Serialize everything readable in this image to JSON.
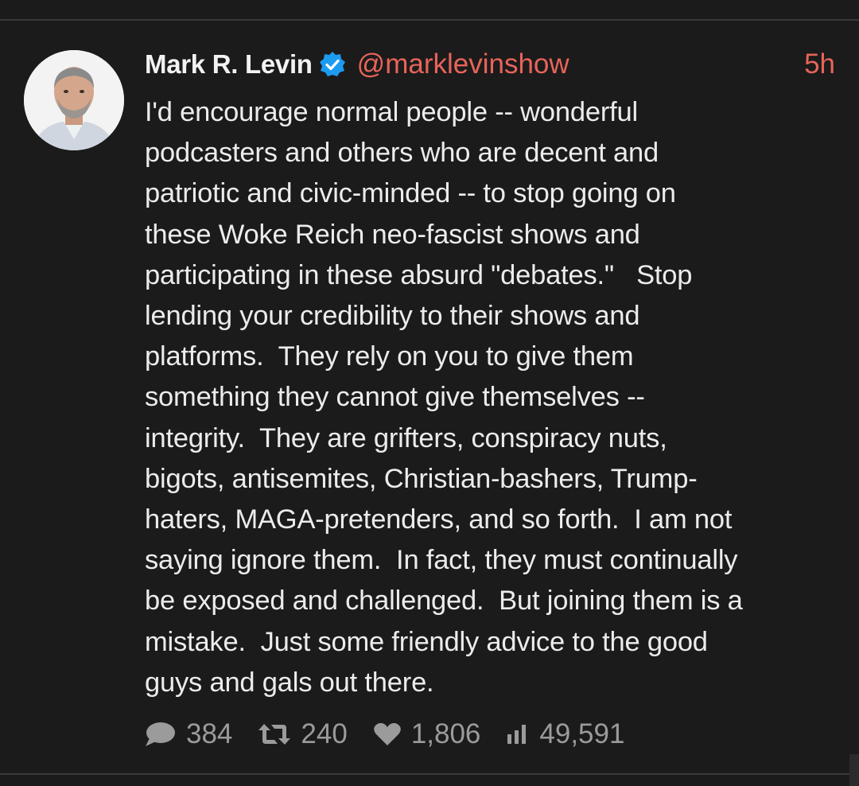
{
  "tweet": {
    "author": {
      "display_name": "Mark R. Levin",
      "handle": "@marklevinshow",
      "verified_icon": "verified-badge-icon"
    },
    "timestamp": "5h",
    "lines": [
      "I'd encourage normal people -- wonderful",
      "podcasters and others who are decent and",
      "patriotic and civic-minded -- to stop going on",
      "these Woke Reich neo-fascist shows and",
      "participating in these absurd \"debates.\"   Stop",
      "lending your credibility to their shows and",
      "platforms.  They rely on you to give them",
      "something they cannot give themselves --",
      "integrity.  They are grifters, conspiracy nuts,",
      "bigots, antisemites, Christian-bashers, Trump-",
      "haters, MAGA-pretenders, and so forth.  I am not",
      "saying ignore them.  In fact, they must continually",
      "be exposed and challenged.  But joining them is a",
      "mistake.  Just some friendly advice to the good",
      "guys and gals out there."
    ],
    "stats": {
      "replies": "384",
      "retweets": "240",
      "likes": "1,806",
      "views": "49,591"
    }
  },
  "colors": {
    "background": "#1b1b1b",
    "text": "#ececec",
    "accent": "#e8645a",
    "verified": "#1d9bf0",
    "muted": "#9b9b9b"
  }
}
